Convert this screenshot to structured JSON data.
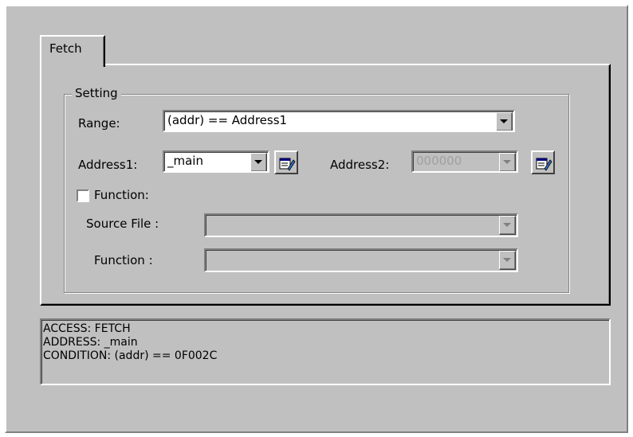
{
  "tab": {
    "label": "Fetch"
  },
  "setting": {
    "group_title": "Setting",
    "range_label": "Range:",
    "range_value": "(addr) == Address1",
    "address1_label": "Address1:",
    "address1_value": "_main",
    "address2_label": "Address2:",
    "address2_value": "000000",
    "function_checkbox_label": "Function:",
    "function_checked": false,
    "source_file_label": "Source File :",
    "source_file_value": "",
    "function_label": "Function :",
    "function_value": ""
  },
  "status": {
    "lines": [
      "ACCESS: FETCH",
      "ADDRESS: _main",
      "CONDITION: (addr) == 0F002C"
    ]
  },
  "icons": [
    "symbol-browse-icon",
    "dropdown-arrow-icon"
  ]
}
